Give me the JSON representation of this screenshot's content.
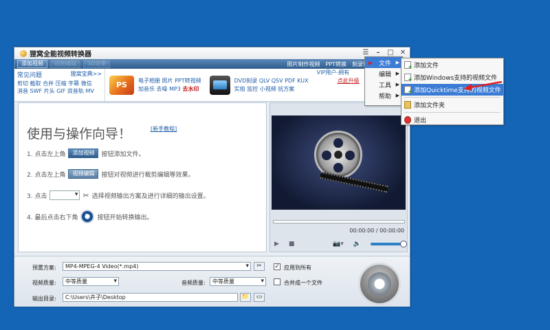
{
  "window": {
    "title": "狸窝全能视频转换器"
  },
  "toolbar": {
    "add_video": "添加视频",
    "edit_video": "视频编辑",
    "effects": "3D效果",
    "links": [
      "照片制作视频",
      "PPT转换",
      "刻录软"
    ]
  },
  "faq": {
    "title": "常见问题",
    "more": "狸窝宝典>>",
    "lines": [
      "剪切 截取 合并 压缩 字幕 微信",
      "消音 SWF 片头 GIF 双音轨 MV"
    ]
  },
  "promo1": {
    "icon": "PS",
    "line1": "电子相册 照片 PPT转视频",
    "line2_prefix": "加音乐 去噪 MP3",
    "line2_bold": "去水印"
  },
  "promo2": {
    "line1": "DVD刻录 QLV QSV PDF KUX",
    "line2": "实拍 监控 小视频 抗方案"
  },
  "vip": {
    "line1": "VIP用户-拥有",
    "line2": "点此升级"
  },
  "guide": {
    "title": "使用与操作向导！",
    "tutorial": "[新手教程]",
    "step1_prefix": "1. 点击左上角",
    "step1_btn": "添加视频",
    "step1_suffix": "按钮添加文件。",
    "step2_prefix": "2. 点击左上角",
    "step2_btn": "视频编辑",
    "step2_suffix": "按钮对视频进行裁剪编辑等效果。",
    "step3_prefix": "3. 点击",
    "step3_suffix": "选择视频输出方案及进行详细的输出设置。",
    "step4_prefix": "4. 最后点击右下角",
    "step4_suffix": "按钮开始转换输出。"
  },
  "player": {
    "time": "00:00:00 / 00:00:00",
    "volume_level": 0.9
  },
  "settings": {
    "preset_label": "预置方案:",
    "preset_value": "MP4-MPEG-4 Video(*.mp4)",
    "apply_all": "应用到所有",
    "apply_all_checked": true,
    "video_quality_label": "视频质量:",
    "video_quality": "中等质量",
    "audio_quality_label": "音频质量:",
    "audio_quality": "中等质量",
    "merge_label": "合并成一个文件",
    "merge_checked": false,
    "output_label": "输出目录:",
    "output_path": "C:\\Users\\卉子\\Desktop"
  },
  "menu": {
    "items": [
      "文件",
      "编辑",
      "工具",
      "帮助"
    ]
  },
  "submenu": {
    "items": [
      "添加文件",
      "添加Windows支持的视频文件",
      "添加Quicktime支持的视频文件",
      "添加文件夹",
      "退出"
    ]
  },
  "colors": {
    "desktop": "#1565b7",
    "highlight": "#3a7bd5",
    "arrow": "#e02020"
  }
}
